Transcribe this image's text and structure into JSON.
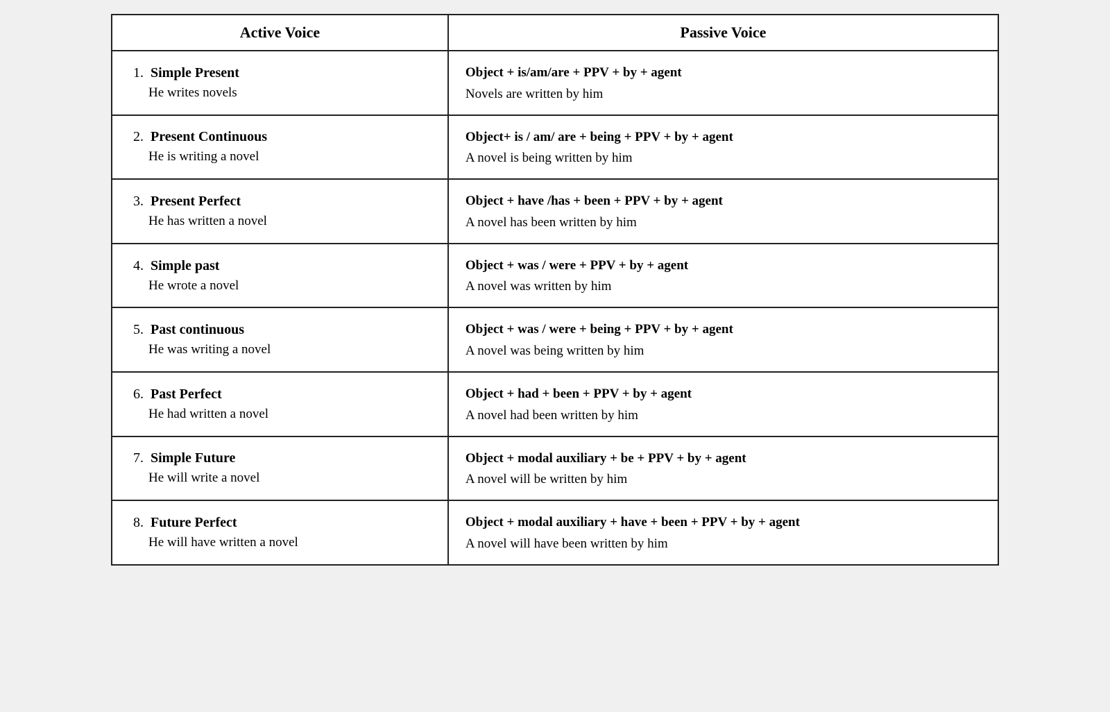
{
  "headers": {
    "active": "Active Voice",
    "passive": "Passive Voice"
  },
  "rows": [
    {
      "number": "1.",
      "tense": "Simple Present",
      "active_example": "He writes novels",
      "passive_formula": "Object + is/am/are + PPV + by + agent",
      "passive_example": "Novels are written by him"
    },
    {
      "number": "2.",
      "tense": "Present Continuous",
      "active_example": "He is writing a novel",
      "passive_formula": "Object+ is / am/ are + being + PPV + by + agent",
      "passive_example": "A novel is being written by him"
    },
    {
      "number": "3.",
      "tense": "Present Perfect",
      "active_example": "He has written a novel",
      "passive_formula": "Object + have /has + been + PPV + by + agent",
      "passive_example": "A novel has been written by him"
    },
    {
      "number": "4.",
      "tense": "Simple past",
      "active_example": "He wrote a novel",
      "passive_formula": "Object + was / were + PPV + by + agent",
      "passive_example": "A novel was written by him"
    },
    {
      "number": "5.",
      "tense": "Past continuous",
      "active_example": "He was writing a novel",
      "passive_formula": "Object + was / were + being + PPV + by + agent",
      "passive_example": "A novel was  being written by him"
    },
    {
      "number": "6.",
      "tense": "Past Perfect",
      "active_example": "He had written a novel",
      "passive_formula": "Object + had + been + PPV + by + agent",
      "passive_example": "A novel had been written by him"
    },
    {
      "number": "7.",
      "tense": "Simple Future",
      "active_example": "He will write a novel",
      "passive_formula": "Object + modal auxiliary + be + PPV + by + agent",
      "passive_example": "A novel will be written by him"
    },
    {
      "number": "8.",
      "tense": "Future Perfect",
      "active_example": "He will have written a novel",
      "passive_formula": "Object + modal auxiliary +  have + been + PPV + by + agent",
      "passive_example": "A novel will have been written by him"
    }
  ]
}
